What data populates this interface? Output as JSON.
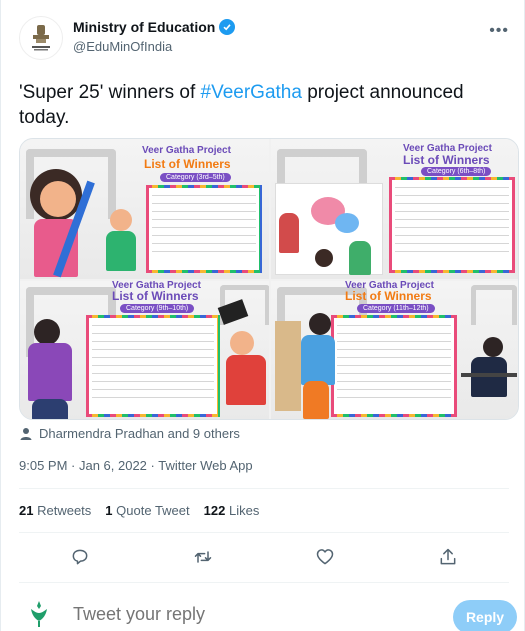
{
  "author": {
    "name": "Ministry of Education",
    "handle": "@EduMinOfIndia"
  },
  "tweet": {
    "text_before": "'Super 25' winners of ",
    "hashtag": "#VeerGatha",
    "text_after": " project announced today."
  },
  "media": {
    "tiles": [
      {
        "title": "Veer Gatha Project",
        "subtitle": "List of Winners",
        "category": "Category (3rd–5th)"
      },
      {
        "title": "Veer Gatha Project",
        "subtitle": "List of Winners",
        "category": "Category (6th–8th)"
      },
      {
        "title": "Veer Gatha Project",
        "subtitle": "List of Winners",
        "category": "Category (9th–10th)"
      },
      {
        "title": "Veer Gatha Project",
        "subtitle": "List of Winners",
        "category": "Category (11th–12th)"
      }
    ]
  },
  "likers": "Dharmendra Pradhan and 9 others",
  "timestamp": "9:05 PM · Jan 6, 2022 · Twitter Web App",
  "stats": {
    "retweets_count": "21",
    "retweets_label": "Retweets",
    "quotes_count": "1",
    "quotes_label": "Quote Tweet",
    "likes_count": "122",
    "likes_label": "Likes"
  },
  "reply": {
    "placeholder": "Tweet your reply",
    "button": "Reply"
  },
  "colors": {
    "accent": "#1d9bf0",
    "reply_button_disabled": "#8ecdf8",
    "text_secondary": "#536471",
    "purple_title": "#6b4bb8",
    "orange_title": "#f27b13"
  }
}
